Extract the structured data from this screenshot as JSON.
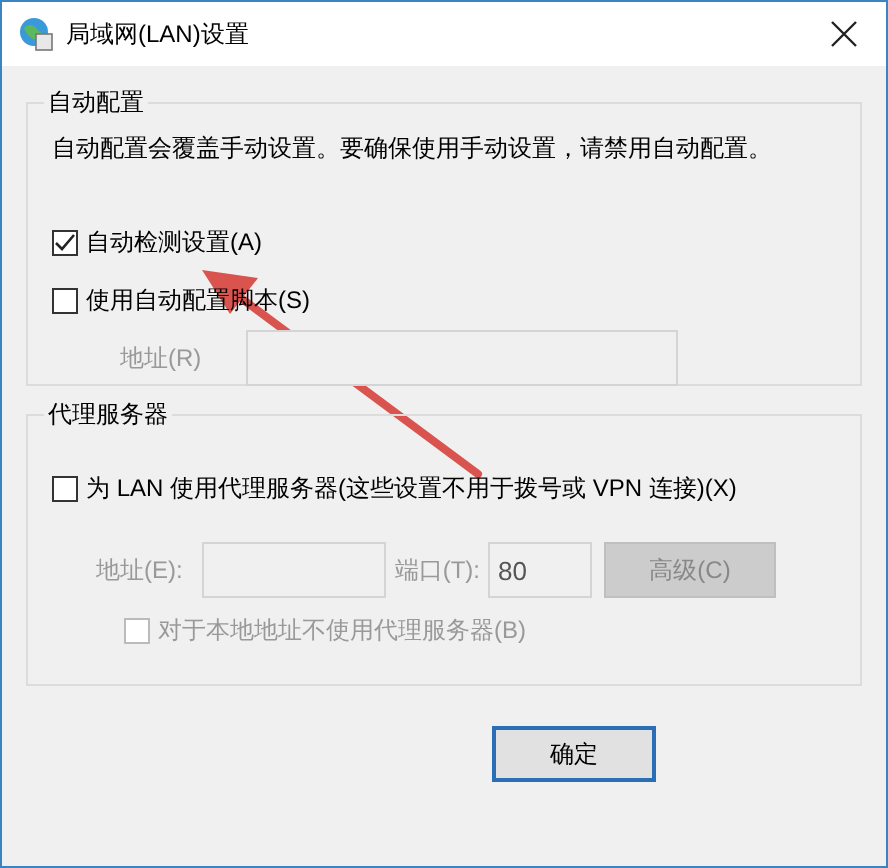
{
  "window": {
    "title": "局域网(LAN)设置"
  },
  "auto_config": {
    "title": "自动配置",
    "note": "自动配置会覆盖手动设置。要确保使用手动设置，请禁用自动配置。",
    "options": [
      {
        "label": "自动检测设置(A)",
        "checked": true
      },
      {
        "label": "使用自动配置脚本(S)",
        "checked": false
      }
    ],
    "address": {
      "label": "地址(R)",
      "disabled": true
    }
  },
  "proxy": {
    "title": "代理服务器",
    "option": {
      "label": "为 LAN 使用代理服务器(这些设置不用于拨号或 VPN 连接)(X)",
      "checked": false
    },
    "address": {
      "label": "地址(E):",
      "disabled": true
    },
    "port": {
      "label": "端口(T):",
      "value": "80",
      "disabled": true
    },
    "advanced_button": {
      "label": "高级(C)",
      "disabled": true
    },
    "bypass": {
      "label": "对于本地地址不使用代理服务器(B)",
      "checked": false,
      "disabled": true
    }
  },
  "buttons": [
    {
      "label": "确定"
    }
  ]
}
